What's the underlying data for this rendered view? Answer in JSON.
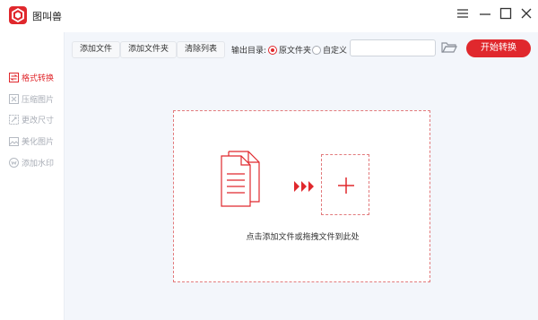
{
  "app": {
    "title": "图叫兽"
  },
  "window_controls": [
    "menu-icon",
    "minimize-icon",
    "maximize-icon",
    "close-icon"
  ],
  "sidebar": {
    "items": [
      {
        "label": "格式转换",
        "icon": "swap-icon",
        "active": true
      },
      {
        "label": "压缩图片",
        "icon": "compress-icon",
        "active": false
      },
      {
        "label": "更改尺寸",
        "icon": "resize-icon",
        "active": false
      },
      {
        "label": "美化图片",
        "icon": "beautify-icon",
        "active": false
      },
      {
        "label": "添加水印",
        "icon": "watermark-icon",
        "active": false
      }
    ]
  },
  "toolbar": {
    "add_file": "添加文件",
    "add_folder": "添加文件夹",
    "clear_list": "清除列表",
    "output_label": "输出目录:",
    "radio_original": "原文件夹",
    "radio_custom": "自定义",
    "output_path_value": "",
    "start": "开始转换"
  },
  "dropzone": {
    "text": "点击添加文件或拖拽文件到此处"
  },
  "colors": {
    "accent": "#e0282d",
    "dashed_border": "#e27a7c",
    "main_bg": "#f3f6fb"
  }
}
